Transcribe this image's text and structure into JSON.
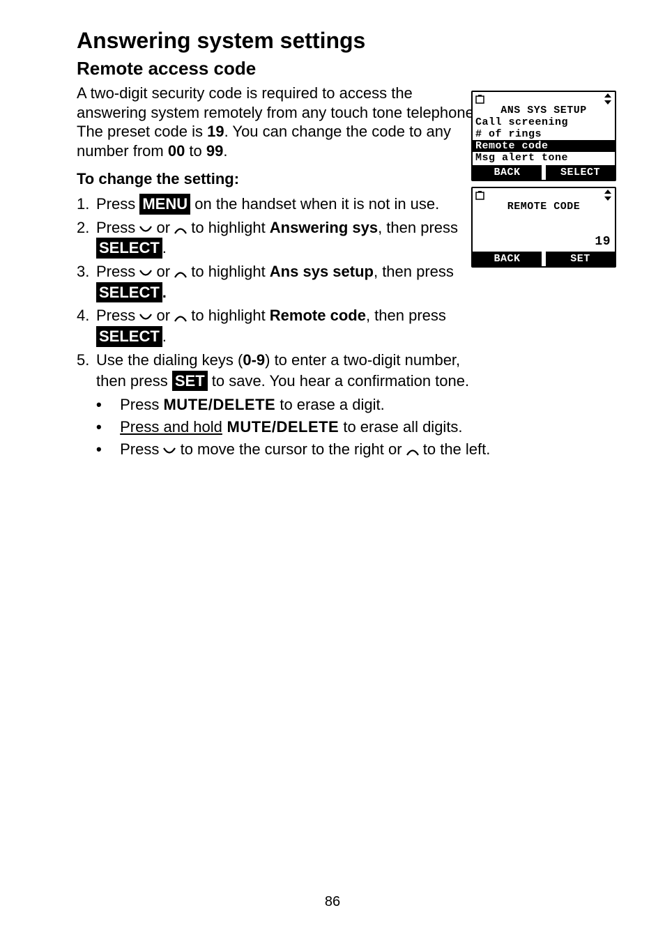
{
  "heading": "Answering system settings",
  "subheading": "Remote access code",
  "intro_1": "A two-digit security code is required to access the answering system remotely from any touch tone telephone. The preset code is ",
  "intro_preset": "19",
  "intro_2": ". You can change the code to any number from ",
  "intro_range_low": "00",
  "intro_mid": " to ",
  "intro_range_high": "99",
  "intro_3": ".",
  "change_heading": "To change the setting:",
  "steps": {
    "s1_a": "Press ",
    "s1_menu": "MENU",
    "s1_b": " on the handset when it is not in use.",
    "s2_a": "Press ",
    "s2_b": " or ",
    "s2_c": " to highlight ",
    "s2_bold": "Answering sys",
    "s2_d": ", then press ",
    "s2_select": "SELECT",
    "s2_e": ".",
    "s3_a": "Press ",
    "s3_b": " or ",
    "s3_c": " to highlight ",
    "s3_bold": "Ans sys setup",
    "s3_d": ", then press ",
    "s3_select": "SELECT",
    "s3_e": ".",
    "s4_a": "Press ",
    "s4_b": " or ",
    "s4_c": " to highlight ",
    "s4_bold": "Remote code",
    "s4_d": ", then press ",
    "s4_select": "SELECT",
    "s4_e": ".",
    "s5_a": "Use the dialing keys (",
    "s5_range": "0-9",
    "s5_b": ") to enter a two-digit number, then press ",
    "s5_set": "SET",
    "s5_c": " to save. You hear a confirmation tone."
  },
  "bullets": {
    "b1_a": "Press ",
    "b1_key": "MUTE/DELETE",
    "b1_b": " to erase a digit.",
    "b2_a": "Press and hold",
    "b2_key": " MUTE/DELETE",
    "b2_b": " to erase all digits.",
    "b3_a": "Press ",
    "b3_b": " to move the cursor to the right or ",
    "b3_c": " to the left."
  },
  "page_number": "86",
  "lcd1": {
    "title": "ANS SYS SETUP",
    "line1": "Call screening",
    "line2": "# of rings",
    "line3": "Remote code",
    "line4": "Msg alert tone",
    "sk_left": "BACK",
    "sk_right": "SELECT"
  },
  "lcd2": {
    "title": "REMOTE CODE",
    "value": "19",
    "sk_left": "BACK",
    "sk_right": "SET"
  }
}
